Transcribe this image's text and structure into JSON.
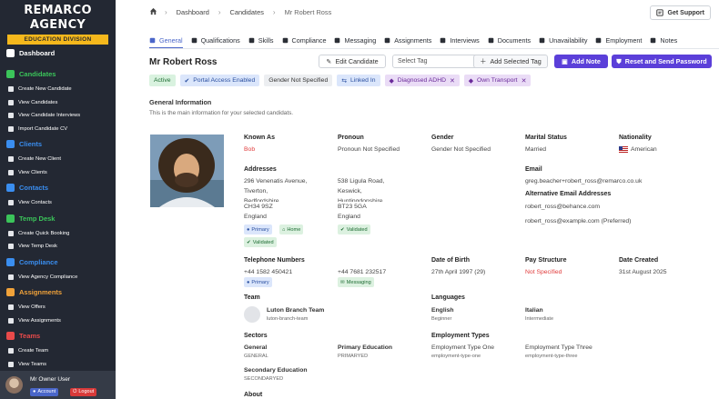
{
  "brand": {
    "title": "REMARCO AGENCY",
    "subtitle": "EDUCATION DIVISION"
  },
  "sidebar": {
    "groups": [
      {
        "label": "Dashboard",
        "color": "#ffffff",
        "items": []
      },
      {
        "label": "Candidates",
        "color": "#3bc45a",
        "items": [
          "Create New Candidate",
          "View Candidates",
          "View Candidate Interviews",
          "Import Candidate CV"
        ]
      },
      {
        "label": "Clients",
        "color": "#3a8ef0",
        "items": [
          "Create New Client",
          "View Clients"
        ]
      },
      {
        "label": "Contacts",
        "color": "#3a8ef0",
        "items": [
          "View Contacts"
        ]
      },
      {
        "label": "Temp Desk",
        "color": "#3bc45a",
        "items": [
          "Create Quick Booking",
          "View Temp Desk"
        ]
      },
      {
        "label": "Compliance",
        "color": "#3a8ef0",
        "items": [
          "View Agency Compliance"
        ]
      },
      {
        "label": "Assignments",
        "color": "#f0a23a",
        "items": [
          "View Offers",
          "View Assignments"
        ]
      },
      {
        "label": "Teams",
        "color": "#e84a4a",
        "items": [
          "Create Team",
          "View Teams"
        ]
      }
    ],
    "user": {
      "name": "Mr Owner User",
      "account": "Account",
      "logout": "Logout"
    }
  },
  "breadcrumb": {
    "items": [
      "Dashboard",
      "Candidates",
      "Mr Robert Ross"
    ]
  },
  "support": "Get Support",
  "tabs": [
    "General",
    "Qualifications",
    "Skills",
    "Compliance",
    "Messaging",
    "Assignments",
    "Interviews",
    "Documents",
    "Unavailability",
    "Employment",
    "Notes"
  ],
  "candidate": {
    "name": "Mr Robert Ross"
  },
  "actions": {
    "edit": "Edit Candidate",
    "select_tag": "Select Tag",
    "add_tag": "Add Selected Tag",
    "add_note": "Add Note",
    "reset": "Reset and Send Password"
  },
  "tags": [
    "Active",
    "Portal Access Enabled",
    "Gender Not Specified",
    "Linked In",
    "Diagnosed ADHD",
    "Own Transport"
  ],
  "section": {
    "title": "General Information",
    "desc": "This is the main information for your selected candidats."
  },
  "details": {
    "known_as_label": "Known As",
    "known_as": "Bob",
    "pronoun_label": "Pronoun",
    "pronoun": "Pronoun Not Specified",
    "gender_label": "Gender",
    "gender": "Gender Not Specified",
    "marital_label": "Marital Status",
    "marital": "Married",
    "nationality_label": "Nationality",
    "nationality": "American",
    "addresses_label": "Addresses",
    "address1": [
      "296 Venenatis Avenue,",
      "Tiverton,",
      "Bedfordshire,",
      "CH34 9SZ",
      "England"
    ],
    "address2": [
      "538 Ligula Road,",
      "Keswick,",
      "Huntingdonshire,",
      "BT23 5GA",
      "England"
    ],
    "primary": "Primary",
    "home": "Home",
    "validated": "Validated",
    "email_label": "Email",
    "email": "greg.beacher+robert_ross@remarco.co.uk",
    "alt_email_label": "Alternative Email Addresses",
    "alt_email1": "robert_ross@behance.com",
    "alt_email2": "robert_ross@example.com (Preferred)",
    "phone_label": "Telephone Numbers",
    "phone1": "+44 1582 450421",
    "phone2": "+44 7681 232517",
    "messaging": "Messaging",
    "dob_label": "Date of Birth",
    "dob": "27th April 1997 (29)",
    "pay_label": "Pay Structure",
    "pay": "Not Specified",
    "created_label": "Date Created",
    "created": "31st August 2025",
    "team_label": "Team",
    "team_name": "Luton Branch Team",
    "team_slug": "luton-branch-team",
    "languages_label": "Languages",
    "lang1": "English",
    "lang1_level": "Beginner",
    "lang2": "Italian",
    "lang2_level": "Intermediate",
    "sectors_label": "Sectors",
    "sector1": "General",
    "sector1_code": "GENERAL",
    "sector2": "Primary Education",
    "sector2_code": "PRIMARYED",
    "sector3": "Secondary Education",
    "sector3_code": "SECONDARYED",
    "emp_types_label": "Employment Types",
    "emp1": "Employment Type One",
    "emp1_code": "employment-type-one",
    "emp2": "Employment Type Three",
    "emp2_code": "employment-type-three",
    "about_label": "About"
  }
}
